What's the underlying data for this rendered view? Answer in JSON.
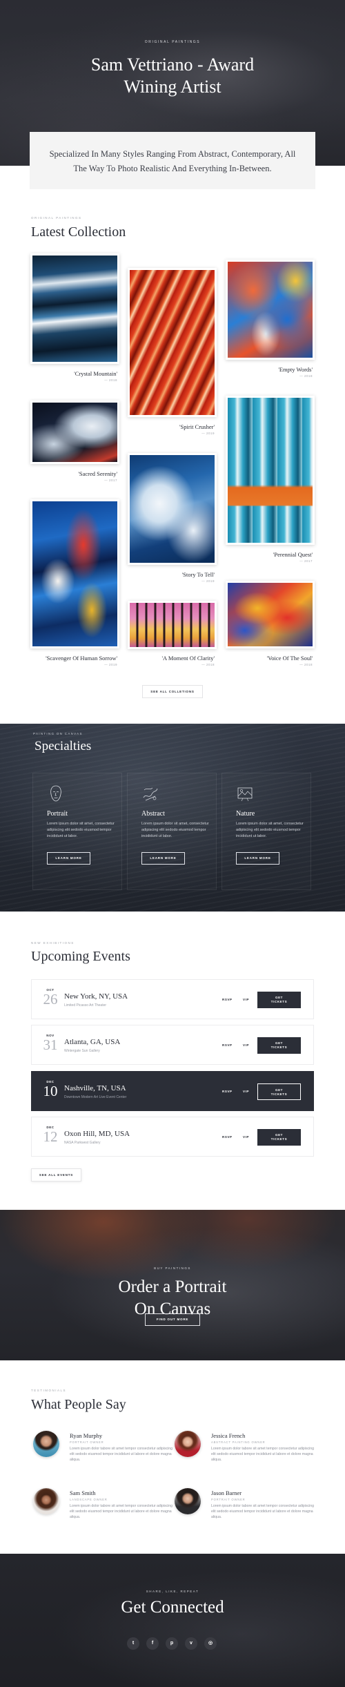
{
  "hero": {
    "eyebrow": "ORIGINAL PAINTINGS",
    "title_line1": "Sam Vettriano - Award",
    "title_line2": "Wining Artist",
    "intro": "Specialized In Many Styles Ranging From Abstract, Contemporary, All The Way To Photo Realistic And Everything In-Between."
  },
  "collection": {
    "eyebrow": "ORIGINAL PAINTINGS",
    "title": "Latest Collection",
    "button": "SEE ALL COLLETIONS",
    "items": [
      {
        "title": "'Crystal Mountain'",
        "year": "— 2018"
      },
      {
        "title": "'Spirit Crusher'",
        "year": "— 2019"
      },
      {
        "title": "'Empty Words'",
        "year": "— 2018"
      },
      {
        "title": "'Sacred Serenity'",
        "year": "— 2017"
      },
      {
        "title": "'Story To Tell'",
        "year": "— 2019"
      },
      {
        "title": "'Perennial Quest'",
        "year": "— 2017"
      },
      {
        "title": "'Scavenger Of Human Sorrow'",
        "year": "— 2019"
      },
      {
        "title": "'A Moment Of Clarity'",
        "year": "— 2018"
      },
      {
        "title": "'Voice Of The Soul'",
        "year": "— 2018"
      }
    ]
  },
  "specialties": {
    "eyebrow": "PAINTING ON CANVAS",
    "title": "Specialties",
    "learn_more": "LEARN MORE",
    "cards": [
      {
        "title": "Portrait",
        "text": "Lorem ipsum dolor sit amet, consectetur adipiscing elit sedodo eiusmod tempor incididunt ut labor.",
        "icon": "face-outline-icon"
      },
      {
        "title": "Abstract",
        "text": "Lorem ipsum dolor sit amet, consectetur adipiscing elit sedodo eiusmod tempor incididunt ut labor.",
        "icon": "abstract-brush-icon"
      },
      {
        "title": "Nature",
        "text": "Lorem ipsum dolor sit amet, consectetur adipiscing elit sedodo eiusmod tempor incididunt ut labor.",
        "icon": "landscape-frame-icon"
      }
    ]
  },
  "events": {
    "eyebrow": "NEW EXHIBITIONS",
    "title": "Upcoming Events",
    "rsvp": "RSVP",
    "vip": "VIP",
    "tickets_line1": "GET",
    "tickets_line2": "TICKETS",
    "see_all": "SEE ALL EVENTS",
    "items": [
      {
        "month": "OCT",
        "day": "26",
        "city": "New York, NY, USA",
        "venue": "Limited Picasso Art Theater"
      },
      {
        "month": "NOV",
        "day": "31",
        "city": "Atlanta, GA, USA",
        "venue": "Wintergate Sun Gallery"
      },
      {
        "month": "DEC",
        "day": "10",
        "city": "Nashville, TN, USA",
        "venue": "Downtown Modern Art Live Event Center"
      },
      {
        "month": "DEC",
        "day": "12",
        "city": "Oxon Hill, MD, USA",
        "venue": "NASA Parkwest Gallery"
      }
    ]
  },
  "order": {
    "eyebrow": "BUY PAINTINGS",
    "title_line1": "Order a Portrait",
    "title_line2": "On Canvas",
    "button": "FIND OUT MORE"
  },
  "testimonials": {
    "eyebrow": "TESTIMONIALS",
    "title": "What People Say",
    "people": [
      {
        "name": "Ryan Murphy",
        "role": "PORTRAIT OWNER",
        "quote": "Lorem ipsum dolor tabore sit amet tempor consectetur adipiscing elit sedodo eiusmod tempor incididunt ut labore et dolore magna aliqua."
      },
      {
        "name": "Jessica French",
        "role": "ABSTRACT PAINTING OWNER",
        "quote": "Lorem ipsum dolor tabore sit amet tempor consectetur adipiscing elit sedodo eiusmod tempor incididunt ut labore et dolore magna aliqua."
      },
      {
        "name": "Sam Smith",
        "role": "LANDSCAPE OWNER",
        "quote": "Lorem ipsum dolor tabore sit amet tempor consectetur adipiscing elit sedodo eiusmod tempor incididunt ut labore et dolore magna aliqua."
      },
      {
        "name": "Jason Barner",
        "role": "PORTRAIT OWNER",
        "quote": "Lorem ipsum dolor tabore sit amet tempor consectetur adipiscing elit sedodo eiusmod tempor incididunt ut labore et dolore magna aliqua."
      }
    ]
  },
  "footer": {
    "eyebrow": "SHARE, LIKE, REPEAT",
    "title": "Get Connected",
    "socials": [
      {
        "icon": "twitter-icon",
        "glyph": "t"
      },
      {
        "icon": "facebook-icon",
        "glyph": "f"
      },
      {
        "icon": "pinterest-icon",
        "glyph": "p"
      },
      {
        "icon": "vimeo-icon",
        "glyph": "v"
      },
      {
        "icon": "instagram-icon",
        "glyph": "◎"
      }
    ]
  },
  "colors": {
    "dark": "#2b2e37",
    "text": "#2a2d36",
    "muted": "#a3a6ad",
    "white": "#ffffff"
  }
}
